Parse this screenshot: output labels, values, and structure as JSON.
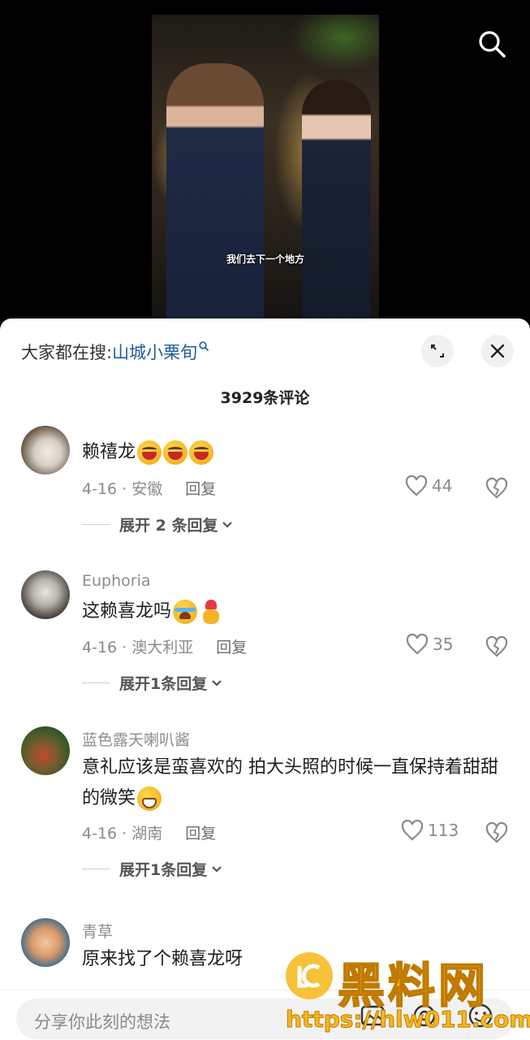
{
  "video": {
    "subtitle": "我们去下一个地方"
  },
  "sheet": {
    "search_prefix": "大家都在搜:",
    "search_term": "山城小栗旬",
    "comment_count": "3929条评论"
  },
  "comments": [
    {
      "username": "",
      "text": "赖禧龙",
      "emojis": [
        "laugh",
        "laugh",
        "laugh"
      ],
      "date_location": "4-16 · 安徽",
      "reply_label": "回复",
      "likes": "44",
      "expand_label": "展开 2 条回复"
    },
    {
      "username": "Euphoria",
      "text": "这赖喜龙吗",
      "emojis": [
        "cry",
        "heart-hand"
      ],
      "date_location": "4-16 · 澳大利亚",
      "reply_label": "回复",
      "likes": "35",
      "expand_label": "展开1条回复"
    },
    {
      "username": "蓝色露天喇叭酱",
      "text": "意礼应该是蛮喜欢的 拍大头照的时候一直保持着甜甜的微笑",
      "emojis": [
        "grin"
      ],
      "date_location": "4-16 · 湖南",
      "reply_label": "回复",
      "likes": "113",
      "expand_label": "展开1条回复"
    },
    {
      "username": "青草",
      "text": "原来找了个赖喜龙呀",
      "emojis": []
    }
  ],
  "input": {
    "placeholder": "分享你此刻的想法"
  },
  "watermark": {
    "title": "黑料网",
    "url": "https://hlw011.com"
  },
  "colors": {
    "link": "#1f5a9a",
    "watermark": "#f5b81c"
  }
}
